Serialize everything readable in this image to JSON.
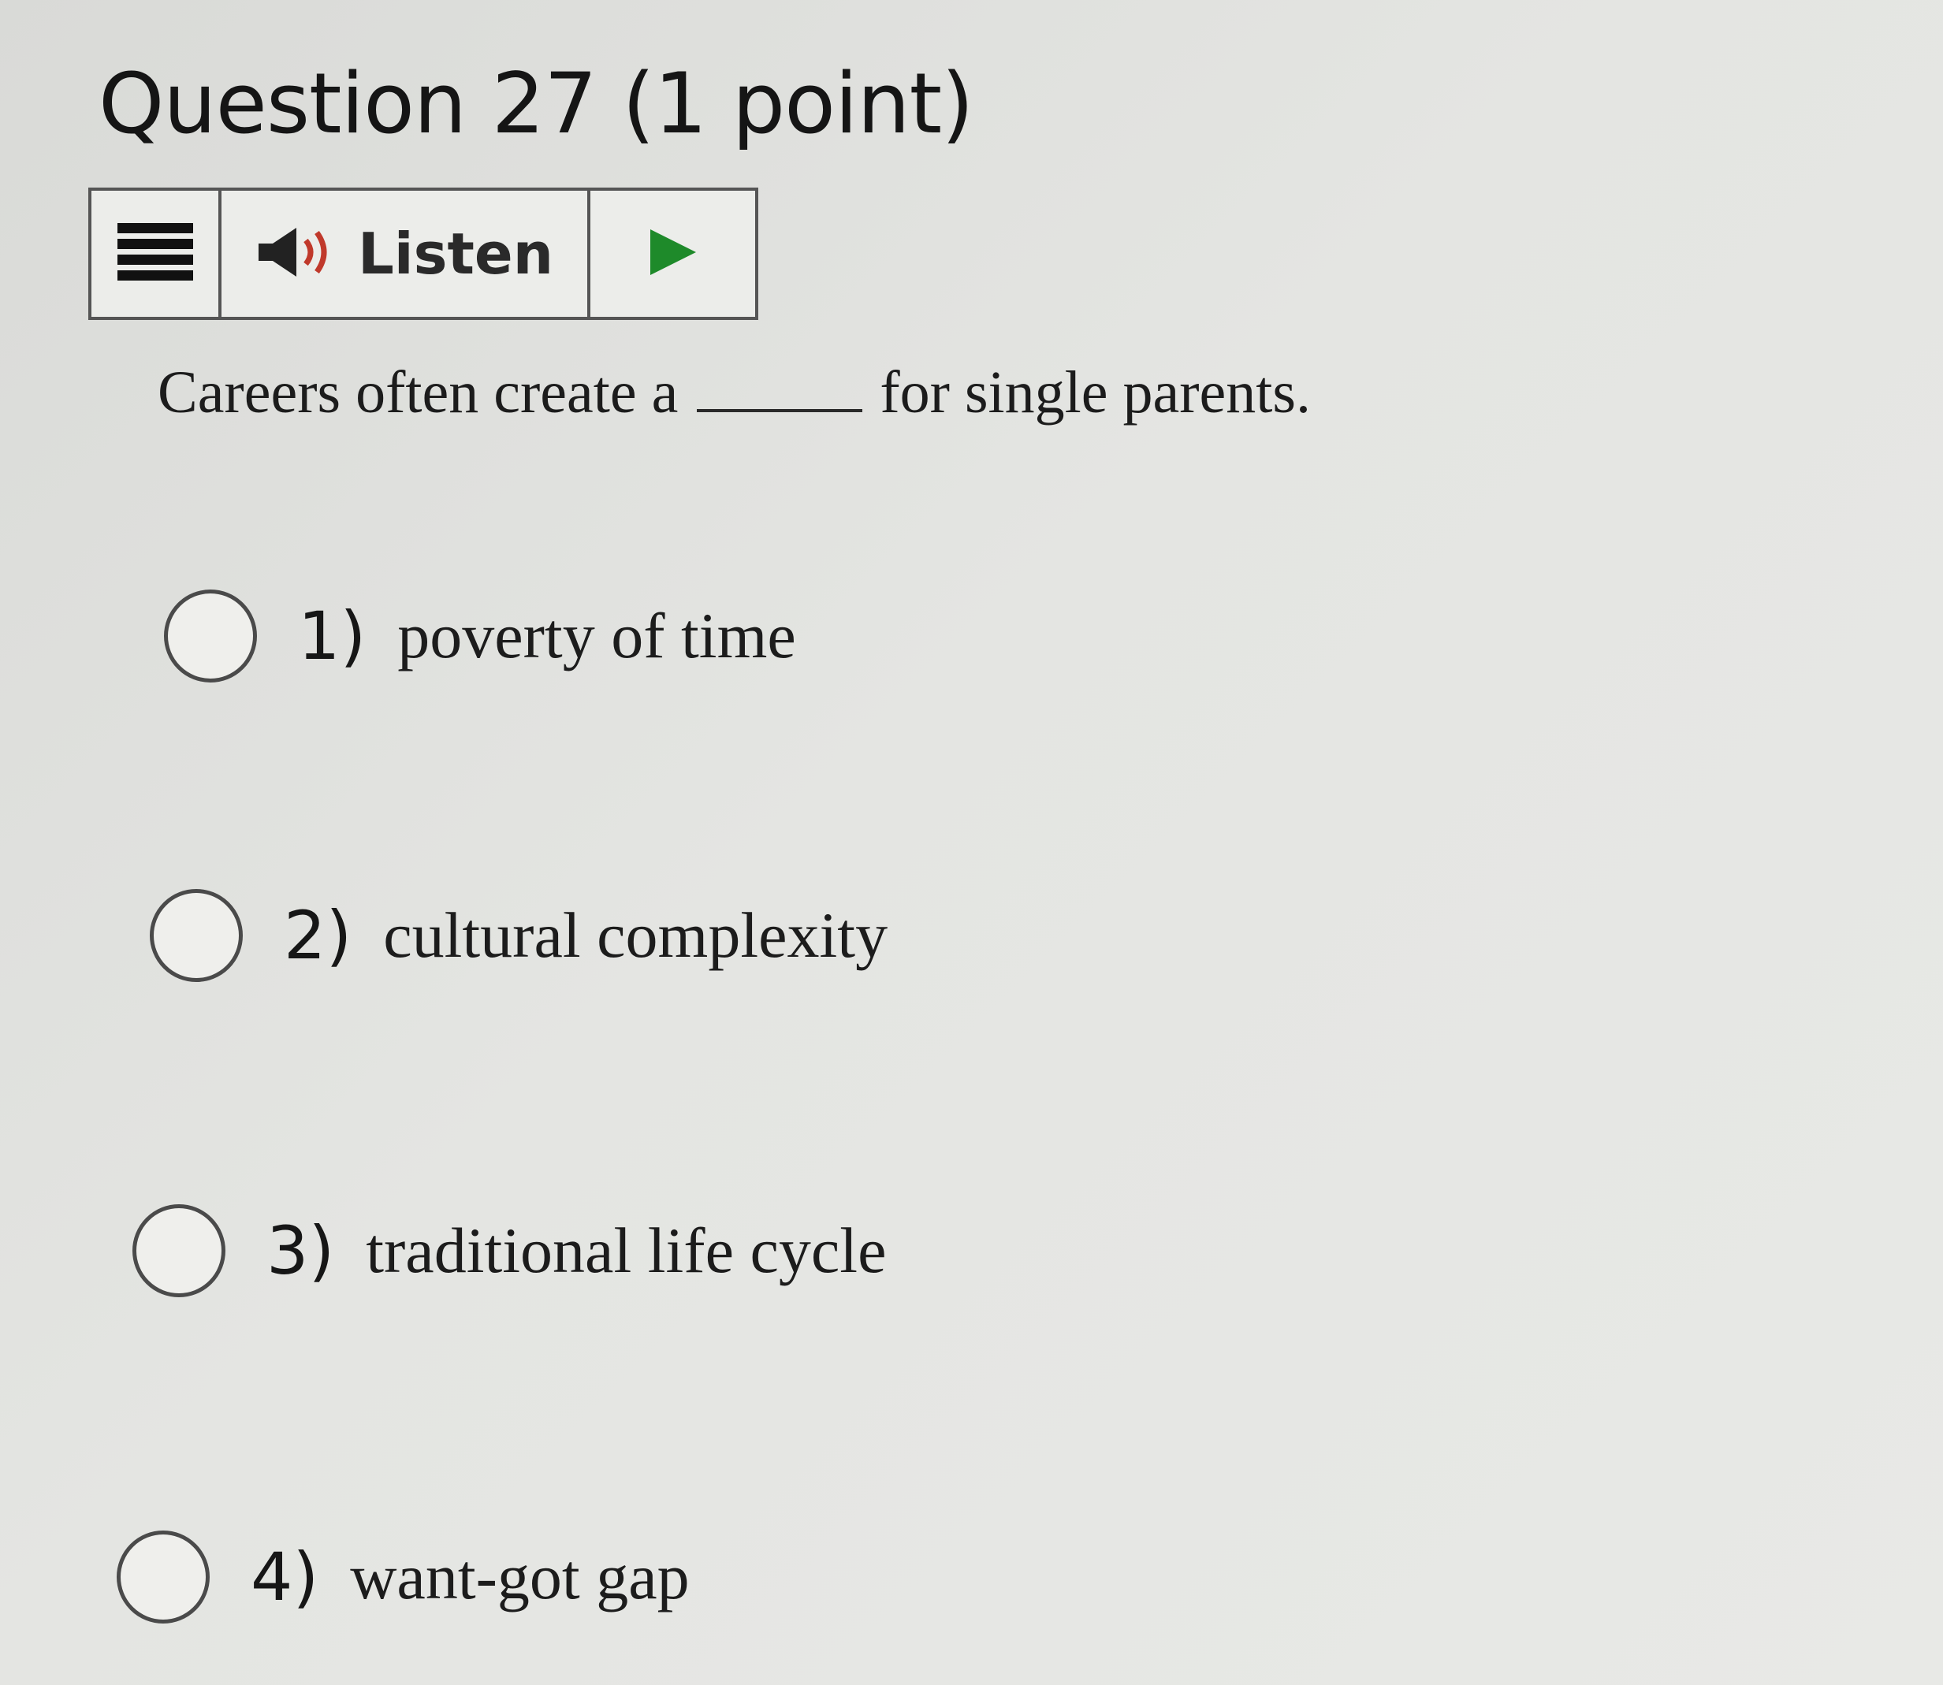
{
  "question": {
    "title": "Question 27 (1 point)",
    "text_before": "Careers often create a",
    "text_after": "for single parents."
  },
  "toolbar": {
    "menu_icon": "menu-icon",
    "speaker_icon": "speaker-icon",
    "listen_label": "Listen",
    "play_icon": "play-icon",
    "play_color": "#1e8a2a",
    "speaker_color": "#222222",
    "speaker_wave_color": "#c0392b"
  },
  "options": [
    {
      "number": "1)",
      "text": "poverty of time",
      "selected": false
    },
    {
      "number": "2)",
      "text": "cultural complexity",
      "selected": false
    },
    {
      "number": "3)",
      "text": "traditional life cycle",
      "selected": false
    },
    {
      "number": "4)",
      "text": "want-got gap",
      "selected": false
    }
  ]
}
